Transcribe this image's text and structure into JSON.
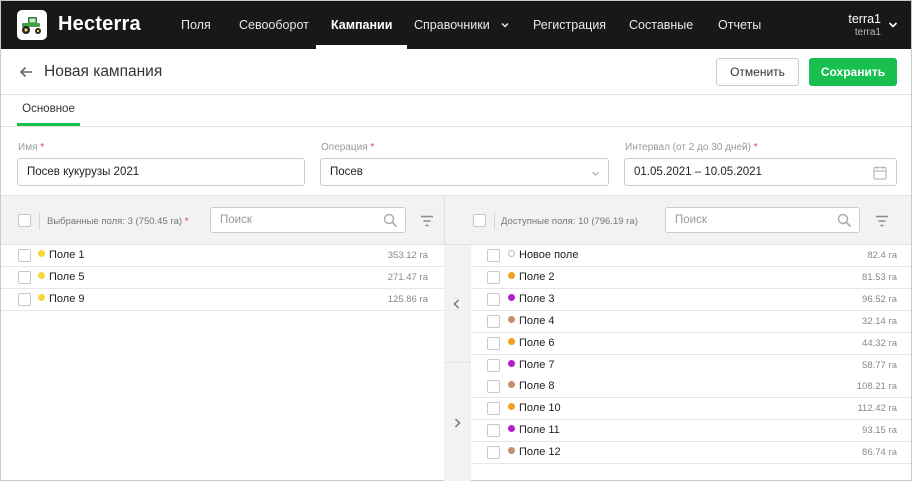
{
  "app": {
    "brand": "Hecterra"
  },
  "nav": {
    "items": [
      "Поля",
      "Севооборот",
      "Кампании",
      "Справочники",
      "Регистрация",
      "Составные",
      "Отчеты"
    ],
    "active": "Кампании",
    "dropdown_item": "Справочники"
  },
  "user": {
    "name": "terra1",
    "account": "terra1"
  },
  "page": {
    "title": "Новая кампания",
    "cancel_label": "Отменить",
    "save_label": "Сохранить"
  },
  "tabs": [
    {
      "label": "Основное",
      "active": true
    }
  ],
  "form": {
    "name": {
      "label": "Имя",
      "required_mark": "*",
      "value": "Посев кукурузы 2021"
    },
    "operation": {
      "label": "Операция",
      "required_mark": "*",
      "value": "Посев"
    },
    "interval": {
      "label": "Интервал (от 2 до 30 дней)",
      "required_mark": "*",
      "value": "01.05.2021 – 10.05.2021"
    }
  },
  "selected_panel": {
    "label": "Выбранные поля: 3 (750.45 га)",
    "required_mark": "*",
    "search_placeholder": "Поиск",
    "rows": [
      {
        "name": "Поле 1",
        "area": "353.12 га",
        "color": "#f5d73a"
      },
      {
        "name": "Поле 5",
        "area": "271.47 га",
        "color": "#f5d73a"
      },
      {
        "name": "Поле 9",
        "area": "125.86 га",
        "color": "#f5d73a"
      }
    ]
  },
  "available_panel": {
    "label": "Доступные поля: 10 (796.19 га)",
    "search_placeholder": "Поиск",
    "rows": [
      {
        "name": "Новое поле",
        "area": "82.4 га",
        "color": ""
      },
      {
        "name": "Поле 2",
        "area": "81.53 га",
        "color": "#f0a020"
      },
      {
        "name": "Поле 3",
        "area": "96.52 га",
        "color": "#b020c8"
      },
      {
        "name": "Поле 4",
        "area": "32.14 га",
        "color": "#c09070"
      },
      {
        "name": "Поле 6",
        "area": "44.32 га",
        "color": "#f0a020"
      },
      {
        "name": "Поле 7",
        "area": "58.77 га",
        "color": "#b020c8"
      },
      {
        "name": "Поле 8",
        "area": "108.21 га",
        "color": "#c09070"
      },
      {
        "name": "Поле 10",
        "area": "112.42 га",
        "color": "#f0a020"
      },
      {
        "name": "Поле 11",
        "area": "93.15 га",
        "color": "#b020c8"
      },
      {
        "name": "Поле 12",
        "area": "86.74 га",
        "color": "#c09070"
      }
    ]
  },
  "colors": {
    "accent": "#17c04f",
    "topbar": "#191817",
    "required": "#e53935"
  }
}
